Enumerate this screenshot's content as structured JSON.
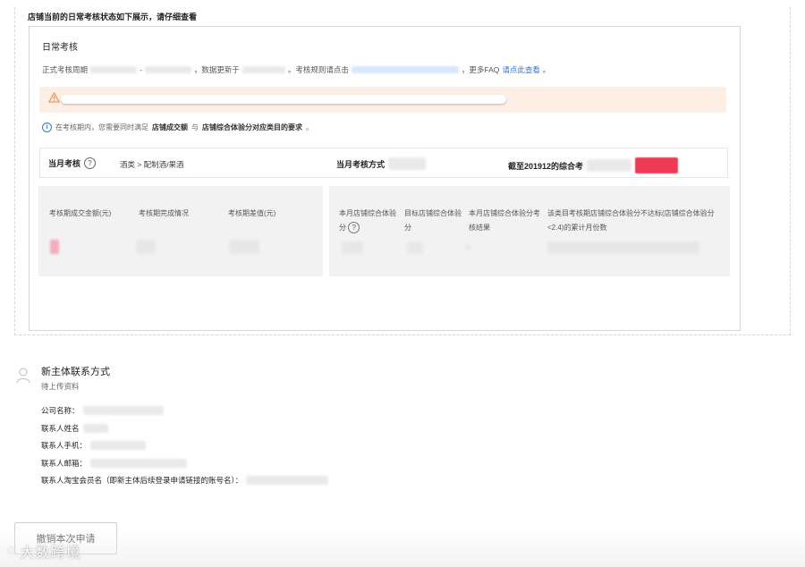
{
  "notice": "店铺当前的日常考核状态如下展示，请仔细查看",
  "card": {
    "title": "日常考核",
    "period_prefix": "正式考核周期",
    "period_sep": "-",
    "data_update": "，数据更新于",
    "rule_text": "。考核规则请点击",
    "faq_prefix": "，更多FAQ",
    "faq_link": "请点此查看",
    "faq_suffix": "。",
    "info_prefix": "在考核期内，您需要同时满足",
    "info_item1": "店铺成交额",
    "info_and": "与",
    "info_item2": "店铺综合体验分对应类目的要求",
    "info_suffix": "。",
    "monthly_label": "当月考核",
    "category_value": "酒类 > 配制酒/果酒",
    "monthly_method": "当月考核方式",
    "as_of": "截至201912的综合考",
    "left_cols": [
      "考核期成交金额(元)",
      "考核期完成情况",
      "考核期差值(元)"
    ],
    "right_cols": [
      "本月店铺综合体验分",
      "目标店铺综合体验分",
      "本月店铺综合体验分考核结果",
      "该类目考核期店铺综合体验分不达标(店铺综合体验分<2.4)的累计月份数"
    ]
  },
  "contact": {
    "title": "新主体联系方式",
    "subtitle": "待上传资料",
    "fields": [
      "公司名称：",
      "联系人姓名",
      "联系人手机：",
      "联系人邮箱：",
      "联系人淘宝会员名（即新主体后续登录申请链接的账号名）："
    ]
  },
  "revoke_button": "撤销本次申请",
  "watermark": "大数跨境",
  "colors": {
    "link": "#2a7ae2",
    "warn_bg": "#fdeee6",
    "panel_bg": "#f2f2f2",
    "highlight": "#ee3b55"
  },
  "icons": [
    "warning-icon",
    "info-icon",
    "question-icon",
    "user-icon"
  ]
}
